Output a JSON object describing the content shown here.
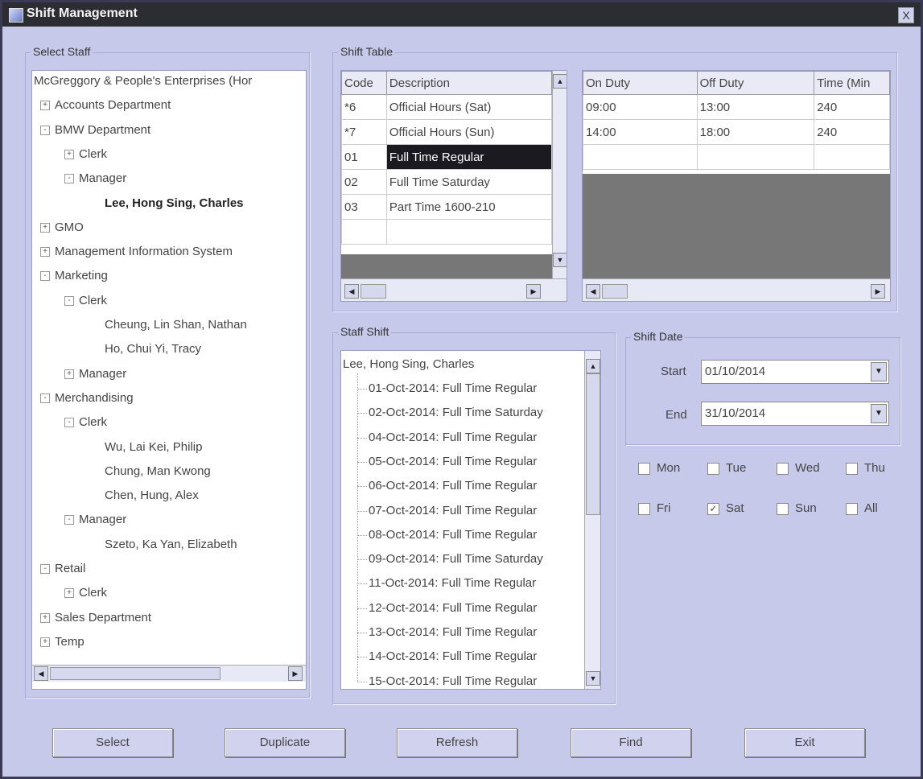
{
  "window": {
    "title": "Shift Management",
    "close_label": "X"
  },
  "select_staff": {
    "label": "Select Staff",
    "tree": [
      {
        "text": "McGreggory & People's Enterprises (Hor",
        "expander": "",
        "bold": false
      },
      {
        "text": "Accounts Department",
        "expander": "+",
        "bold": false
      },
      {
        "text": "BMW Department",
        "expander": "-",
        "bold": false
      },
      {
        "text": "Clerk",
        "expander": "+",
        "bold": false
      },
      {
        "text": "Manager",
        "expander": "-",
        "bold": false
      },
      {
        "text": "Lee, Hong Sing, Charles",
        "expander": "",
        "bold": true
      },
      {
        "text": "GMO",
        "expander": "+",
        "bold": false
      },
      {
        "text": "Management Information System",
        "expander": "+",
        "bold": false
      },
      {
        "text": "Marketing",
        "expander": "-",
        "bold": false
      },
      {
        "text": "Clerk",
        "expander": "-",
        "bold": false
      },
      {
        "text": "Cheung, Lin Shan, Nathan",
        "expander": "",
        "bold": false
      },
      {
        "text": "Ho, Chui Yi, Tracy",
        "expander": "",
        "bold": false
      },
      {
        "text": "Manager",
        "expander": "+",
        "bold": false
      },
      {
        "text": "Merchandising",
        "expander": "-",
        "bold": false
      },
      {
        "text": "Clerk",
        "expander": "-",
        "bold": false
      },
      {
        "text": "Wu, Lai Kei, Philip",
        "expander": "",
        "bold": false
      },
      {
        "text": "Chung, Man Kwong",
        "expander": "",
        "bold": false
      },
      {
        "text": "Chen, Hung, Alex",
        "expander": "",
        "bold": false
      },
      {
        "text": "Manager",
        "expander": "-",
        "bold": false
      },
      {
        "text": "Szeto, Ka Yan, Elizabeth",
        "expander": "",
        "bold": false
      },
      {
        "text": "Retail",
        "expander": "-",
        "bold": false
      },
      {
        "text": "Clerk",
        "expander": "+",
        "bold": false
      },
      {
        "text": "Sales Department",
        "expander": "+",
        "bold": false
      },
      {
        "text": "Temp",
        "expander": "+",
        "bold": false
      }
    ]
  },
  "shift_table": {
    "label": "Shift Table",
    "left_headers": [
      "Code",
      "Description"
    ],
    "left_rows": [
      [
        "*6",
        "Official Hours (Sat)"
      ],
      [
        "*7",
        "Official Hours (Sun)"
      ],
      [
        "01",
        "Full Time Regular"
      ],
      [
        "02",
        "Full Time Saturday"
      ],
      [
        "03",
        "Part Time 1600-210"
      ],
      [
        "",
        ""
      ]
    ],
    "selected_row": 2,
    "right_headers": [
      "On Duty",
      "Off Duty",
      "Time (Min"
    ],
    "right_rows": [
      [
        "09:00",
        "13:00",
        "240"
      ],
      [
        "14:00",
        "18:00",
        "240"
      ],
      [
        "",
        "",
        ""
      ]
    ]
  },
  "staff_shift": {
    "label": "Staff Shift",
    "root": "Lee, Hong Sing, Charles",
    "items": [
      "01-Oct-2014: Full Time Regular",
      "02-Oct-2014: Full Time Saturday",
      "04-Oct-2014: Full Time Regular",
      "05-Oct-2014: Full Time Regular",
      "06-Oct-2014: Full Time Regular",
      "07-Oct-2014: Full Time Regular",
      "08-Oct-2014: Full Time Regular",
      "09-Oct-2014: Full Time Saturday",
      "11-Oct-2014: Full Time Regular",
      "12-Oct-2014: Full Time Regular",
      "13-Oct-2014: Full Time Regular",
      "14-Oct-2014: Full Time Regular",
      "15-Oct-2014: Full Time Regular"
    ]
  },
  "shift_date": {
    "label": "Shift Date",
    "start_label": "Start",
    "start_value": "01/10/2014",
    "end_label": "End",
    "end_value": "31/10/2014"
  },
  "days": [
    {
      "label": "Mon",
      "checked": false
    },
    {
      "label": "Tue",
      "checked": false
    },
    {
      "label": "Wed",
      "checked": false
    },
    {
      "label": "Thu",
      "checked": false
    },
    {
      "label": "Fri",
      "checked": false
    },
    {
      "label": "Sat",
      "checked": true
    },
    {
      "label": "Sun",
      "checked": false
    },
    {
      "label": "All",
      "checked": false
    }
  ],
  "buttons": {
    "select": "Select",
    "duplicate": "Duplicate",
    "refresh": "Refresh",
    "find": "Find",
    "exit": "Exit"
  }
}
